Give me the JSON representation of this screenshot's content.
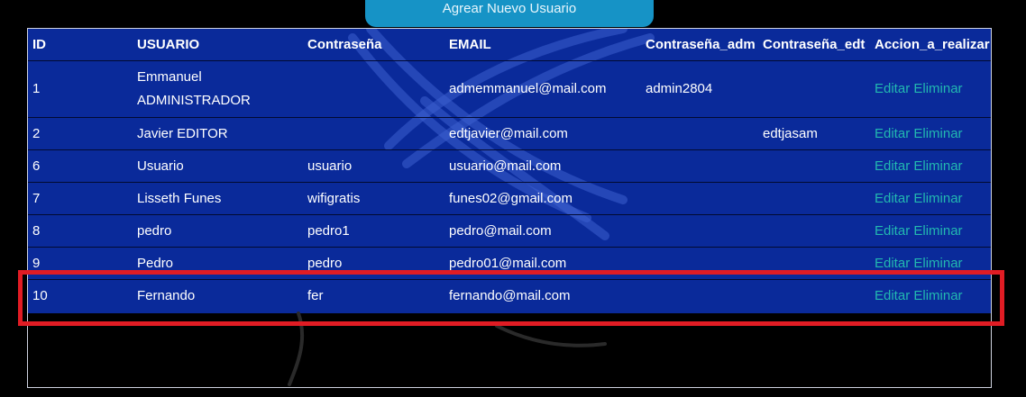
{
  "add_button_label": "Agrear Nuevo Usuario",
  "table": {
    "headers": {
      "id": "ID",
      "usuario": "USUARIO",
      "contrasena": "Contraseña",
      "email": "EMAIL",
      "contrasena_adm": "Contraseña_adm",
      "contrasena_edt": "Contraseña_edt",
      "accion": "Accion_a_realizar"
    },
    "rows": [
      {
        "id": "1",
        "usuario_line1": "Emmanuel",
        "usuario_line2": "ADMINISTRADOR",
        "contrasena": "",
        "email": "admemmanuel@mail.com",
        "contrasena_adm": "admin2804",
        "contrasena_edt": "",
        "edit": "Editar",
        "delete": "Eliminar"
      },
      {
        "id": "2",
        "usuario": "Javier EDITOR",
        "contrasena": "",
        "email": "edtjavier@mail.com",
        "contrasena_adm": "",
        "contrasena_edt": "edtjasam",
        "edit": "Editar",
        "delete": "Eliminar"
      },
      {
        "id": "6",
        "usuario": "Usuario",
        "contrasena": "usuario",
        "email": "usuario@mail.com",
        "contrasena_adm": "",
        "contrasena_edt": "",
        "edit": "Editar",
        "delete": "Eliminar"
      },
      {
        "id": "7",
        "usuario": "Lisseth Funes",
        "contrasena": "wifigratis",
        "email": "funes02@gmail.com",
        "contrasena_adm": "",
        "contrasena_edt": "",
        "edit": "Editar",
        "delete": "Eliminar"
      },
      {
        "id": "8",
        "usuario": "pedro",
        "contrasena": "pedro1",
        "email": "pedro@mail.com",
        "contrasena_adm": "",
        "contrasena_edt": "",
        "edit": "Editar",
        "delete": "Eliminar"
      },
      {
        "id": "9",
        "usuario": "Pedro",
        "contrasena": "pedro",
        "email": "pedro01@mail.com",
        "contrasena_adm": "",
        "contrasena_edt": "",
        "edit": "Editar",
        "delete": "Eliminar"
      },
      {
        "id": "10",
        "usuario": "Fernando",
        "contrasena": "fer",
        "email": "fernando@mail.com",
        "contrasena_adm": "",
        "contrasena_edt": "",
        "edit": "Editar",
        "delete": "Eliminar"
      }
    ]
  },
  "colors": {
    "table_background": "#0a2a9a",
    "button_background": "#1693c6",
    "action_link": "#22b8b0",
    "highlight_border": "#e01c24"
  }
}
